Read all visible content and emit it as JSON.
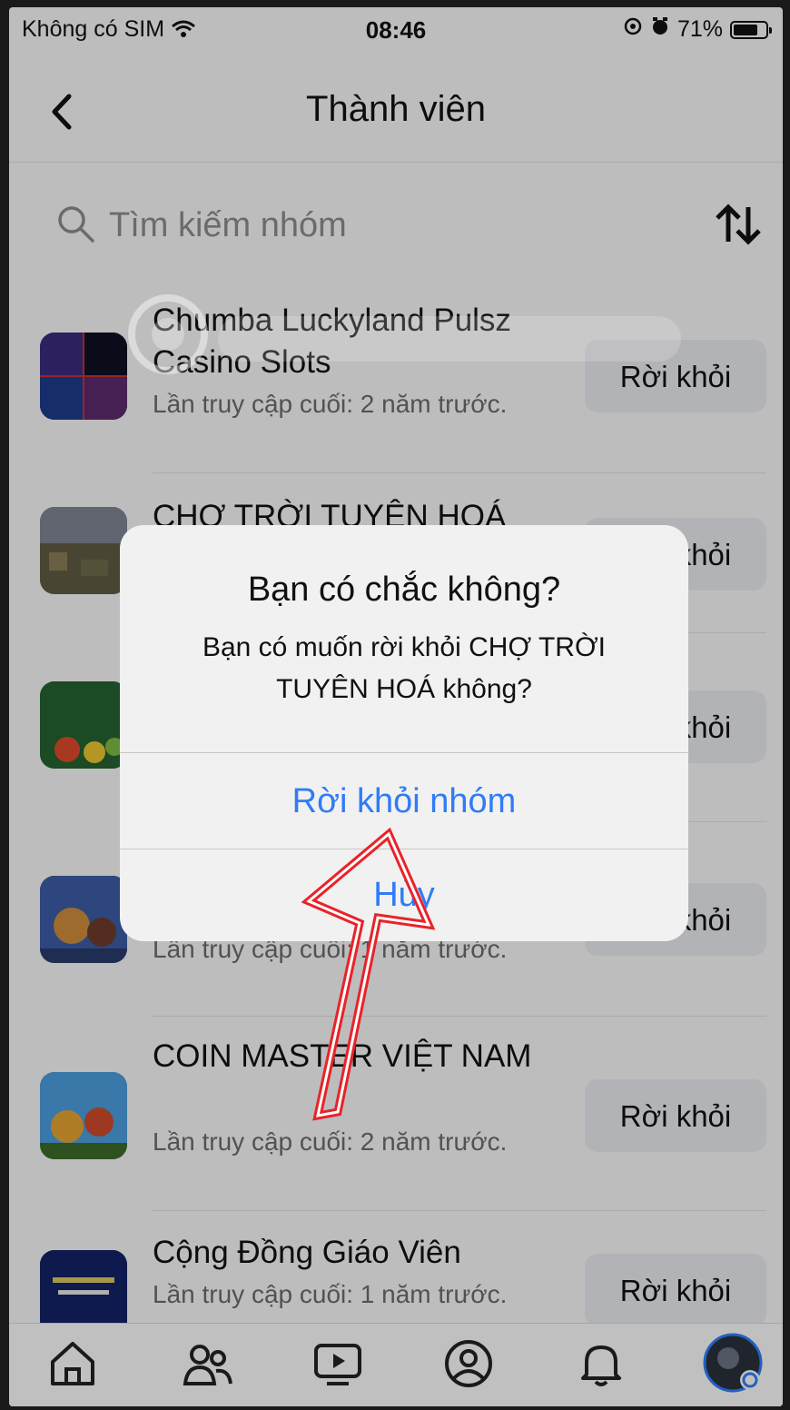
{
  "status_bar": {
    "carrier": "Không có SIM",
    "time": "08:46",
    "battery": "71%"
  },
  "header": {
    "title": "Thành viên"
  },
  "search": {
    "placeholder": "Tìm kiếm nhóm"
  },
  "groups": [
    {
      "name": "Chumba Luckyland Pulsz Casino Slots",
      "meta": "Lần truy cập cuối: 2 năm trước.",
      "action": "Rời khỏi"
    },
    {
      "name": "CHỢ TRỜI TUYÊN HOÁ",
      "meta": "",
      "action": "Rời khỏi"
    },
    {
      "name": "",
      "meta": "",
      "action": "Rời khỏi"
    },
    {
      "name": "",
      "meta": "Lần truy cập cuối: 1 năm trước.",
      "action": "Rời khỏi"
    },
    {
      "name": "COIN MASTER VIỆT NAM",
      "meta": "Lần truy cập cuối: 2 năm trước.",
      "action": "Rời khỏi"
    },
    {
      "name": "Cộng Đồng Giáo Viên",
      "meta": "Lần truy cập cuối: 1 năm trước.",
      "action": "Rời khỏi"
    }
  ],
  "dialog": {
    "title": "Bạn có chắc không?",
    "message": "Bạn có muốn rời khỏi CHỢ TRỜI TUYÊN HOÁ không?",
    "confirm": "Rời khỏi nhóm",
    "cancel": "Hủy"
  },
  "tab_bar": [
    "home-icon",
    "groups-icon",
    "video-icon",
    "profile-icon",
    "bell-icon",
    "avatar"
  ],
  "colors": {
    "accent": "#2f7cf6",
    "annotation_arrow": "#e8232a"
  }
}
